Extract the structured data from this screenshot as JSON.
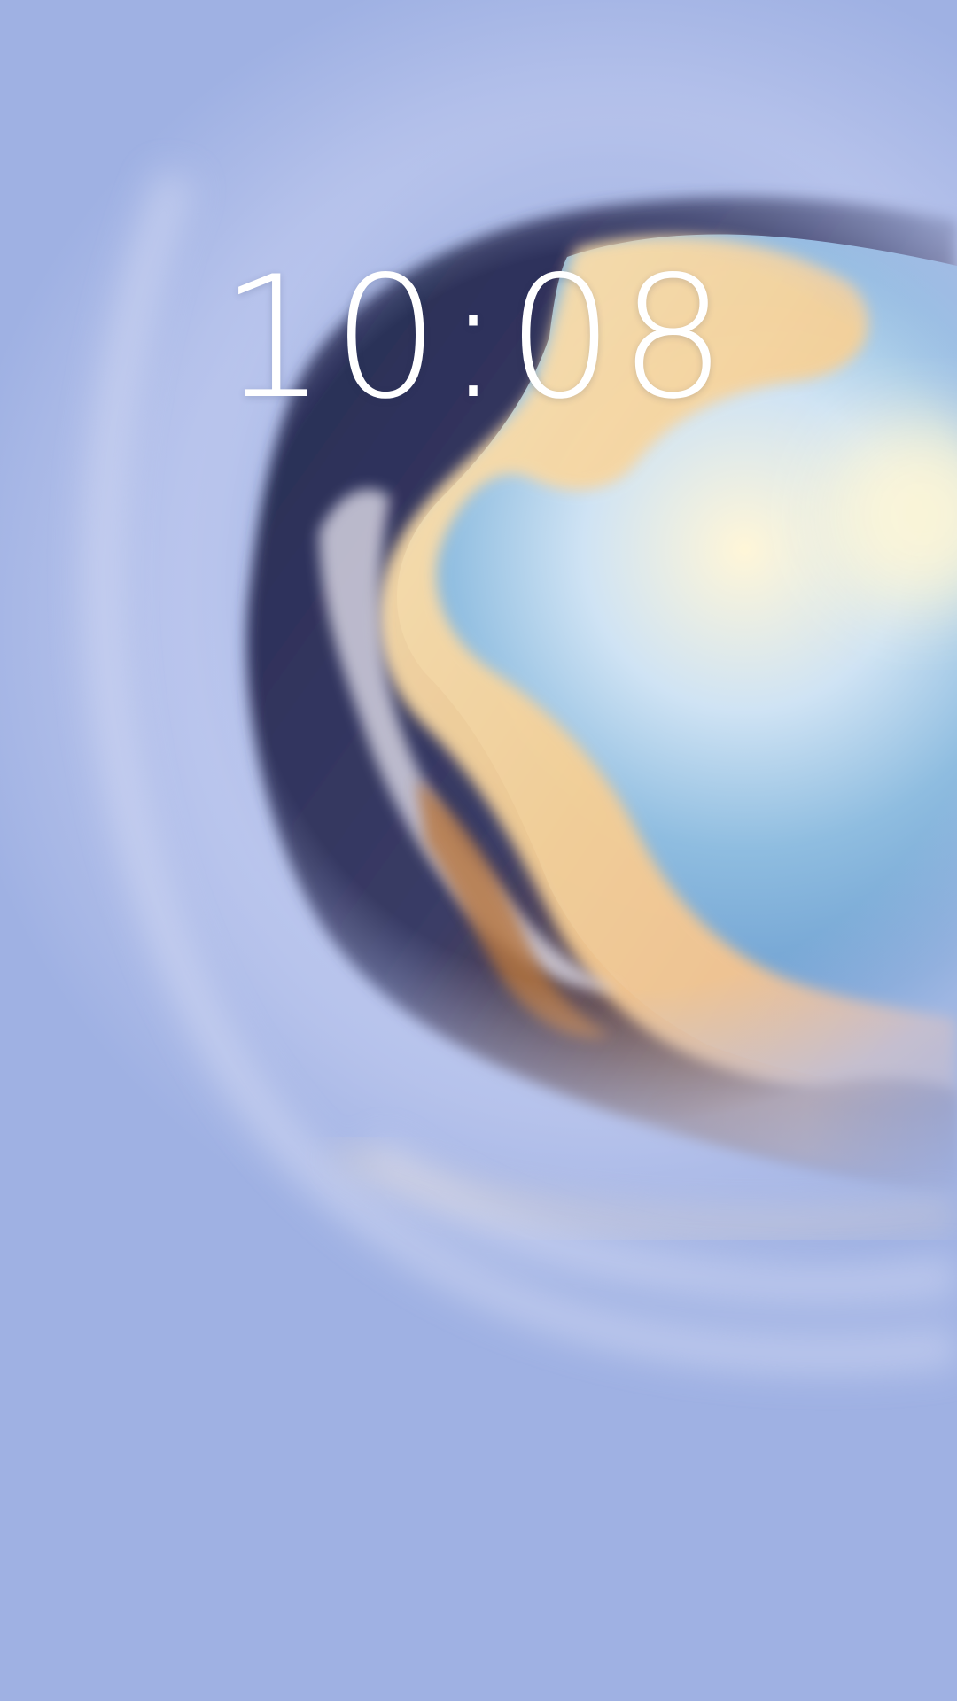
{
  "lockscreen": {
    "time": "10:08"
  },
  "colors": {
    "sky_top": "#9fb3e6",
    "sky_bottom": "#879fd9",
    "cloud_warm": "#f6d7a3",
    "rock_dark": "#2b2f55",
    "rock_warm": "#b8763e",
    "clock_text": "#ffffff"
  }
}
